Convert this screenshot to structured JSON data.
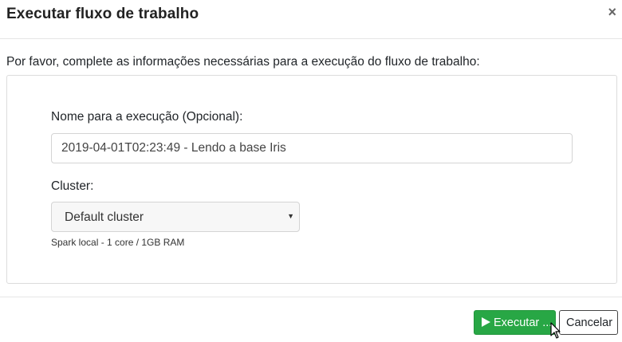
{
  "modal": {
    "title": "Executar fluxo de trabalho",
    "close_symbol": "×",
    "intro": "Por favor, complete as informações necessárias para a execução do fluxo de trabalho:"
  },
  "form": {
    "name_label": "Nome para a execução (Opcional):",
    "name_value": "2019-04-01T02:23:49 - Lendo a base Iris",
    "cluster_label": "Cluster:",
    "cluster_selected": "Default cluster",
    "cluster_help": "Spark local - 1 core / 1GB RAM"
  },
  "footer": {
    "run_label": "Executar ...",
    "cancel_label": "Cancelar"
  },
  "icons": {
    "run": "play-icon",
    "close": "close-icon",
    "select": "chevron-down-icon",
    "pointer": "mouse-cursor-icon"
  },
  "colors": {
    "run_button": "#28a745",
    "border": "#dcdcdc"
  }
}
